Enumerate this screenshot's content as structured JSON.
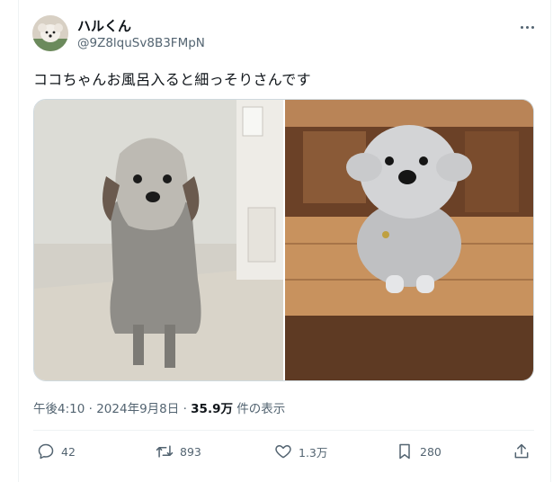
{
  "colors": {
    "text_primary": "#0f1419",
    "text_secondary": "#536471",
    "border": "#cfd9de"
  },
  "author": {
    "display_name": "ハルくん",
    "handle": "@9Z8lquSv8B3FMpN"
  },
  "tweet": {
    "text": "ココちゃんお風呂入ると細っそりさんです",
    "time": "午後4:10",
    "date": "2024年9月8日",
    "views_count": "35.9万",
    "views_label": "件の表示",
    "separator": "·"
  },
  "media": [
    {
      "icon": "photo-wet-dog"
    },
    {
      "icon": "photo-fluffy-dog"
    }
  ],
  "actions": {
    "reply": {
      "icon": "reply-icon",
      "count": "42"
    },
    "retweet": {
      "icon": "retweet-icon",
      "count": "893"
    },
    "like": {
      "icon": "heart-icon",
      "count": "1.3万"
    },
    "bookmark": {
      "icon": "bookmark-icon",
      "count": "280"
    },
    "share": {
      "icon": "share-icon"
    }
  }
}
